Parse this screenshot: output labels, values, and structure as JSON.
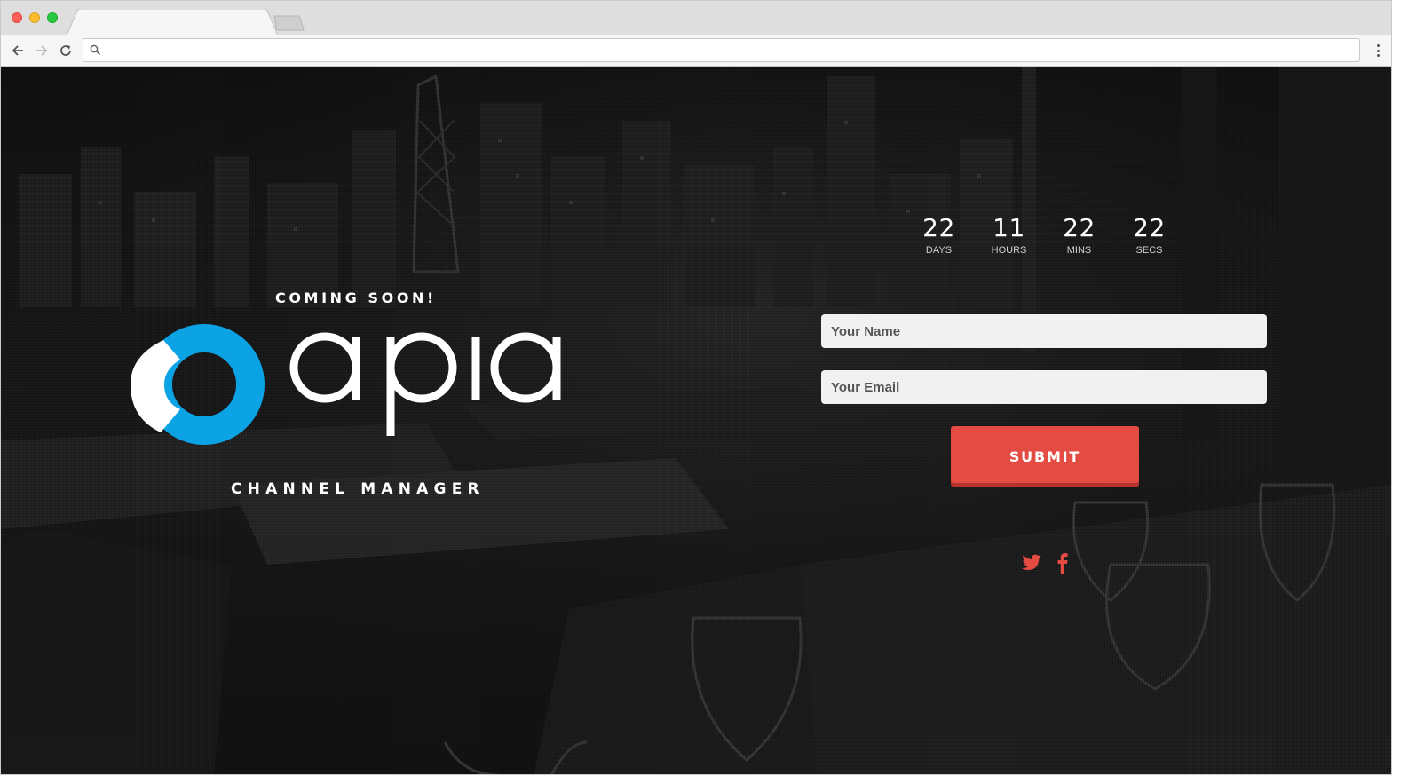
{
  "browser": {
    "address_value": "",
    "address_placeholder": "",
    "tab_title": ""
  },
  "page": {
    "coming_soon": "COMING SOON!",
    "brand_word": "apia",
    "tagline": "CHANNEL MANAGER",
    "logo_colors": {
      "accent": "#0ba3e3",
      "light": "#ffffff"
    },
    "countdown": [
      {
        "value": "22",
        "label": "DAYS"
      },
      {
        "value": "11",
        "label": "HOURS"
      },
      {
        "value": "22",
        "label": "MINS"
      },
      {
        "value": "22",
        "label": "SECS"
      }
    ],
    "form": {
      "name_placeholder": "Your Name",
      "email_placeholder": "Your Email",
      "submit_label": "SUBMIT"
    },
    "social": [
      {
        "icon": "twitter-icon",
        "color": "#e44b43"
      },
      {
        "icon": "facebook-icon",
        "color": "#e44b43"
      }
    ],
    "colors": {
      "accent_red": "#e44b43",
      "background": "#161616"
    }
  }
}
